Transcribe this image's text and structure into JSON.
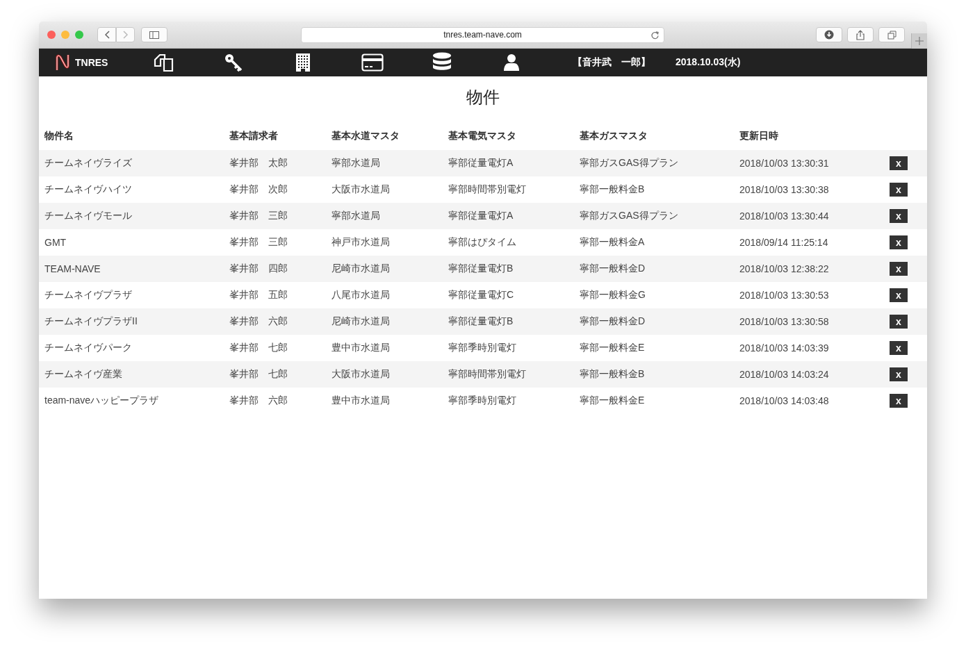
{
  "browser": {
    "url": "tnres.team-nave.com"
  },
  "nav": {
    "brand": "TNRES",
    "user": "【音井武　一郎】",
    "date": "2018.10.03(水)"
  },
  "page": {
    "title": "物件"
  },
  "table": {
    "columns": [
      "物件名",
      "基本請求者",
      "基本水道マスタ",
      "基本電気マスタ",
      "基本ガスマスタ",
      "更新日時"
    ],
    "rows": [
      {
        "cells": [
          "チームネイヴライズ",
          "峯井部　太郎",
          "寧部水道局",
          "寧部従量電灯A",
          "寧部ガスGAS得プラン",
          "2018/10/03 13:30:31"
        ],
        "action": "x"
      },
      {
        "cells": [
          "チームネイヴハイツ",
          "峯井部　次郎",
          "大阪市水道局",
          "寧部時間帯別電灯",
          "寧部一般料金B",
          "2018/10/03 13:30:38"
        ],
        "action": "x"
      },
      {
        "cells": [
          "チームネイヴモール",
          "峯井部　三郎",
          "寧部水道局",
          "寧部従量電灯A",
          "寧部ガスGAS得プラン",
          "2018/10/03 13:30:44"
        ],
        "action": "x"
      },
      {
        "cells": [
          "GMT",
          "峯井部　三郎",
          "神戸市水道局",
          "寧部はぴタイム",
          "寧部一般料金A",
          "2018/09/14 11:25:14"
        ],
        "action": "x"
      },
      {
        "cells": [
          "TEAM-NAVE",
          "峯井部　四郎",
          "尼崎市水道局",
          "寧部従量電灯B",
          "寧部一般料金D",
          "2018/10/03 12:38:22"
        ],
        "action": "x"
      },
      {
        "cells": [
          "チームネイヴプラザ",
          "峯井部　五郎",
          "八尾市水道局",
          "寧部従量電灯C",
          "寧部一般料金G",
          "2018/10/03 13:30:53"
        ],
        "action": "x"
      },
      {
        "cells": [
          "チームネイヴプラザII",
          "峯井部　六郎",
          "尼崎市水道局",
          "寧部従量電灯B",
          "寧部一般料金D",
          "2018/10/03 13:30:58"
        ],
        "action": "x"
      },
      {
        "cells": [
          "チームネイヴパーク",
          "峯井部　七郎",
          "豊中市水道局",
          "寧部季時別電灯",
          "寧部一般料金E",
          "2018/10/03 14:03:39"
        ],
        "action": "x"
      },
      {
        "cells": [
          "チームネイヴ産業",
          "峯井部　七郎",
          "大阪市水道局",
          "寧部時間帯別電灯",
          "寧部一般料金B",
          "2018/10/03 14:03:24"
        ],
        "action": "x"
      },
      {
        "cells": [
          "team-naveハッピープラザ",
          "峯井部　六郎",
          "豊中市水道局",
          "寧部季時別電灯",
          "寧部一般料金E",
          "2018/10/03 14:03:48"
        ],
        "action": "x"
      }
    ]
  }
}
